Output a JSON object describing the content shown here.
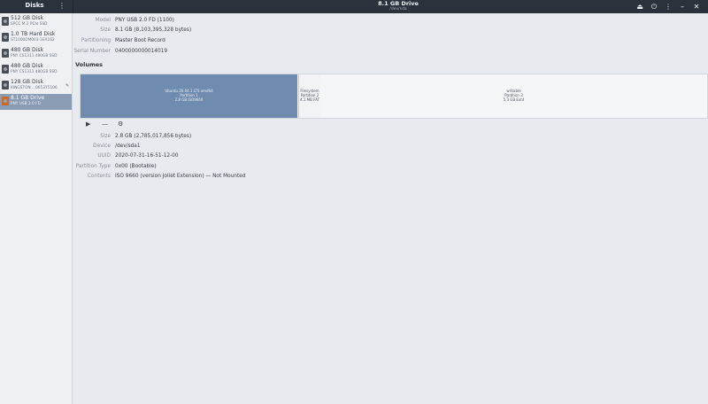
{
  "header": {
    "sidebar_title": "Disks",
    "title": "8.1 GB Drive",
    "subtitle": "/dev/sda",
    "actions": [
      "eject-icon",
      "power-icon",
      "menu-icon",
      "minimize-icon",
      "close-icon"
    ]
  },
  "sidebar": {
    "items": [
      {
        "name": "512 GB Disk",
        "sub": "SPCC M.2 PCIe SSD",
        "selected": false
      },
      {
        "name": "1.0 TB Hard Disk",
        "sub": "ST1000DM003-1ER162",
        "selected": false
      },
      {
        "name": "480 GB Disk",
        "sub": "PNY CS1311 480GB SSD",
        "selected": false
      },
      {
        "name": "480 GB Disk",
        "sub": "PNY CS1311 480GB SSD",
        "selected": false
      },
      {
        "name": "128 GB Disk",
        "sub": "KINGSTON ...065375106",
        "selected": false
      },
      {
        "name": "8.1 GB Drive",
        "sub": "PNY USB 2.0 FD",
        "selected": true
      }
    ]
  },
  "drive_info": {
    "model": {
      "label": "Model",
      "value": "PNY USB 2.0 FD (1100)"
    },
    "size": {
      "label": "Size",
      "value": "8.1 GB (8,103,395,328 bytes)"
    },
    "partitioning": {
      "label": "Partitioning",
      "value": "Master Boot Record"
    },
    "serial": {
      "label": "Serial Number",
      "value": "0400000000014019"
    }
  },
  "volumes": {
    "title": "Volumes",
    "partitions": [
      {
        "line1": "Ubuntu 20.04.1 LTS amd64",
        "line2": "Partition 1",
        "line3": "2.8 GB ISO9660"
      },
      {
        "line1": "Filesystem",
        "line2": "Partition 2",
        "line3": "4.1 MB FAT"
      },
      {
        "line1": "writable",
        "line2": "Partition 3",
        "line3": "5.3 GB Ext4"
      }
    ],
    "toolbar": [
      "play-icon",
      "minus-icon",
      "gear-icon"
    ]
  },
  "volume_details": {
    "size": {
      "label": "Size",
      "value": "2.8 GB (2,785,017,856 bytes)"
    },
    "device": {
      "label": "Device",
      "value": "/dev/sda1"
    },
    "uuid": {
      "label": "UUID",
      "value": "2020-07-31-16-51-12-00"
    },
    "partition_type": {
      "label": "Partition Type",
      "value": "0x00 (Bootable)"
    },
    "contents": {
      "label": "Contents",
      "value": "ISO 9660 (version Joliet Extension) — Not Mounted"
    }
  }
}
